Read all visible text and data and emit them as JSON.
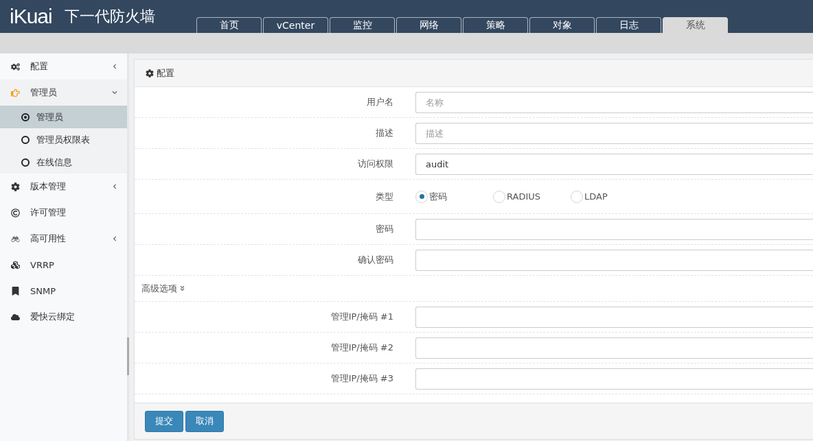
{
  "header": {
    "logo": "iKuai",
    "title": "下一代防火墙"
  },
  "tabs": [
    {
      "label": "首页",
      "selected": false
    },
    {
      "label": "vCenter",
      "selected": false
    },
    {
      "label": "监控",
      "selected": false
    },
    {
      "label": "网络",
      "selected": false
    },
    {
      "label": "策略",
      "selected": false
    },
    {
      "label": "对象",
      "selected": false
    },
    {
      "label": "日志",
      "selected": false
    },
    {
      "label": "系统",
      "selected": true
    }
  ],
  "sidebar": {
    "items": [
      {
        "label": "配置",
        "expanded": false
      },
      {
        "label": "管理员",
        "expanded": true,
        "children": [
          {
            "label": "管理员",
            "selected": true
          },
          {
            "label": "管理员权限表",
            "selected": false
          },
          {
            "label": "在线信息",
            "selected": false
          }
        ]
      },
      {
        "label": "版本管理",
        "expanded": false
      },
      {
        "label": "许可管理"
      },
      {
        "label": "高可用性",
        "expanded": false
      },
      {
        "label": "VRRP"
      },
      {
        "label": "SNMP"
      },
      {
        "label": "爱快云绑定"
      }
    ]
  },
  "panel": {
    "title": "配置",
    "fields": [
      {
        "kind": "text",
        "label": "用户名",
        "placeholder": "名称"
      },
      {
        "kind": "text",
        "label": "描述",
        "placeholder": "描述"
      },
      {
        "kind": "text",
        "label": "访问权限",
        "value": "audit"
      },
      {
        "kind": "radio",
        "label": "类型",
        "options": [
          {
            "label": "密码",
            "selected": true
          },
          {
            "label": "RADIUS",
            "selected": false
          },
          {
            "label": "LDAP",
            "selected": false
          }
        ]
      },
      {
        "kind": "password",
        "label": "密码"
      },
      {
        "kind": "password",
        "label": "确认密码"
      }
    ],
    "advanced": {
      "label": "高级选项",
      "expanded": true,
      "fields": [
        {
          "kind": "text",
          "label": "管理IP/掩码 #1"
        },
        {
          "kind": "text",
          "label": "管理IP/掩码 #2"
        },
        {
          "kind": "text",
          "label": "管理IP/掩码 #3"
        }
      ]
    },
    "buttons": [
      "提交",
      "取消"
    ]
  }
}
